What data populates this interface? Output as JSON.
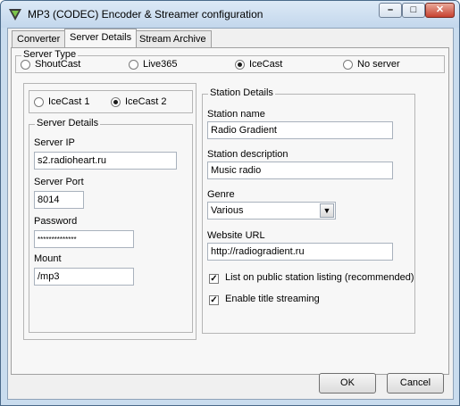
{
  "window": {
    "title": "MP3 (CODEC) Encoder & Streamer configuration",
    "minimize": "–",
    "maximize": "□",
    "close": "✕"
  },
  "tabs": [
    "Converter",
    "Server Details",
    "Stream Archive"
  ],
  "server_type": {
    "label": "Server Type",
    "options": [
      "ShoutCast",
      "Live365",
      "IceCast",
      "No server"
    ],
    "selected": "IceCast"
  },
  "icecast_version": {
    "options": [
      "IceCast 1",
      "IceCast 2"
    ],
    "selected": "IceCast 2"
  },
  "server_details": {
    "label": "Server Details",
    "server_ip_label": "Server IP",
    "server_ip": "s2.radioheart.ru",
    "server_port_label": "Server Port",
    "server_port": "8014",
    "password_label": "Password",
    "password": "**************",
    "mount_label": "Mount",
    "mount": "/mp3"
  },
  "station_details": {
    "label": "Station Details",
    "name_label": "Station name",
    "name": "Radio Gradient",
    "description_label": "Station description",
    "description": "Music radio",
    "genre_label": "Genre",
    "genre": "Various",
    "website_label": "Website URL",
    "website": "http://radiogradient.ru",
    "list_public_label": "List on public station listing (recommended)",
    "list_public_checked": true,
    "title_streaming_label": "Enable title streaming",
    "title_streaming_checked": true,
    "check_mark": "✓"
  },
  "buttons": {
    "ok": "OK",
    "cancel": "Cancel"
  }
}
